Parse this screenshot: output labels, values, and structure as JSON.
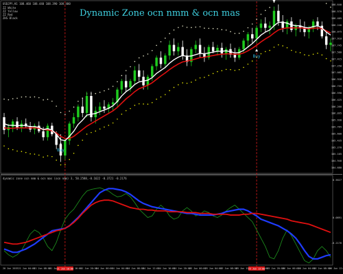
{
  "window": {
    "symbol_line": "USDJPY,H1  108.460 108.440 108.390 108.400",
    "legend_items": [
      "ZZ White",
      "ZZ Yellow",
      "ZZ Red",
      "ZHS Black"
    ],
    "title": "Dynamic Zone ocn nmm & ocn mas"
  },
  "indicator_panel": {
    "label": "dynamic zone ocn nmm & ocn mas (ocn nmm) 3, 50.2588,-0.1622 -0.3721 -0.2176"
  },
  "colors": {
    "background": "#000000",
    "bull_candle": "#1ecb1e",
    "bear_candle": "#ffffff",
    "white_ma": "#ffffff",
    "red_ma": "#e01010",
    "upper_dots": "#e6e6c8",
    "lower_dots": "#e6e600",
    "signal_text": "#2fb6e0",
    "blue_line": "#1f3cff",
    "green_line": "#1c8a1c",
    "vline": "#d81a1a"
  },
  "chart_data": [
    {
      "type": "candlestick",
      "title": "Dynamic Zone ocn nmm & ocn mas",
      "ylim": [
        104.68,
        108.64
      ],
      "y_ticks": [
        "108.640",
        "108.570",
        "108.405",
        "108.240",
        "108.075",
        "107.910",
        "107.745",
        "107.580",
        "107.415",
        "107.250",
        "107.085",
        "106.920",
        "106.755",
        "106.590",
        "106.425",
        "106.260",
        "106.095",
        "105.930",
        "105.765",
        "105.600",
        "105.435",
        "105.270",
        "105.105",
        "104.940",
        "104.680"
      ],
      "x_ticks": [
        "20 Jun 2019",
        "21 Jun 04:00",
        "21 Jun 08:00",
        "21 Jun 12:00",
        "21 Jun 16:00",
        "21 Jun 20:00",
        "24 Jun 00:00",
        "24 Jun 04:00",
        "24 Jun 08:00",
        "24 Jun 12:00",
        "24 Jun 16:00",
        "24 Jun 20:00",
        "25 Jun 00:00",
        "25 Jun 04:00",
        "25 Jun 08:00",
        "25 Jun 12:00",
        "25 Jun 16:00",
        "25 Jun 20:00",
        "26 Jun 00:00",
        "26 Jun 04:00",
        "26 Jun 08:00",
        "26 Jun 12:00"
      ],
      "highlighted_x_ticks": [
        "21 Jun 10:00",
        "25 Jun 13:00"
      ],
      "vertical_lines_at_candle": [
        14,
        58
      ],
      "candles": [
        {
          "o": 105.95,
          "h": 106.05,
          "l": 105.55,
          "c": 105.65
        },
        {
          "o": 105.65,
          "h": 105.8,
          "l": 105.48,
          "c": 105.72
        },
        {
          "o": 105.72,
          "h": 105.9,
          "l": 105.6,
          "c": 105.85
        },
        {
          "o": 105.85,
          "h": 105.95,
          "l": 105.65,
          "c": 105.7
        },
        {
          "o": 105.7,
          "h": 105.88,
          "l": 105.6,
          "c": 105.8
        },
        {
          "o": 105.8,
          "h": 105.92,
          "l": 105.7,
          "c": 105.74
        },
        {
          "o": 105.74,
          "h": 105.84,
          "l": 105.6,
          "c": 105.66
        },
        {
          "o": 105.66,
          "h": 105.8,
          "l": 105.55,
          "c": 105.75
        },
        {
          "o": 105.75,
          "h": 105.85,
          "l": 105.58,
          "c": 105.62
        },
        {
          "o": 105.62,
          "h": 105.72,
          "l": 105.4,
          "c": 105.48
        },
        {
          "o": 105.48,
          "h": 105.8,
          "l": 105.4,
          "c": 105.75
        },
        {
          "o": 105.75,
          "h": 105.82,
          "l": 105.5,
          "c": 105.55
        },
        {
          "o": 105.55,
          "h": 105.62,
          "l": 105.2,
          "c": 105.3
        },
        {
          "o": 105.3,
          "h": 105.55,
          "l": 104.9,
          "c": 105.05
        },
        {
          "o": 105.05,
          "h": 105.45,
          "l": 104.95,
          "c": 105.4
        },
        {
          "o": 105.4,
          "h": 105.85,
          "l": 105.3,
          "c": 105.8
        },
        {
          "o": 105.8,
          "h": 106.05,
          "l": 105.7,
          "c": 105.95
        },
        {
          "o": 105.95,
          "h": 106.25,
          "l": 105.85,
          "c": 106.2
        },
        {
          "o": 106.2,
          "h": 106.4,
          "l": 105.95,
          "c": 106.05
        },
        {
          "o": 106.05,
          "h": 106.55,
          "l": 105.95,
          "c": 106.45
        },
        {
          "o": 106.45,
          "h": 106.55,
          "l": 105.85,
          "c": 105.95
        },
        {
          "o": 105.95,
          "h": 106.2,
          "l": 105.8,
          "c": 106.1
        },
        {
          "o": 106.1,
          "h": 106.3,
          "l": 106.0,
          "c": 106.2
        },
        {
          "o": 106.2,
          "h": 106.35,
          "l": 106.05,
          "c": 106.15
        },
        {
          "o": 106.15,
          "h": 106.3,
          "l": 106.05,
          "c": 106.25
        },
        {
          "o": 106.25,
          "h": 106.4,
          "l": 106.1,
          "c": 106.3
        },
        {
          "o": 106.3,
          "h": 106.65,
          "l": 106.2,
          "c": 106.6
        },
        {
          "o": 106.6,
          "h": 106.85,
          "l": 106.5,
          "c": 106.8
        },
        {
          "o": 106.8,
          "h": 106.95,
          "l": 106.55,
          "c": 106.65
        },
        {
          "o": 106.65,
          "h": 106.85,
          "l": 106.55,
          "c": 106.8
        },
        {
          "o": 106.8,
          "h": 107.15,
          "l": 106.7,
          "c": 107.05
        },
        {
          "o": 107.05,
          "h": 107.2,
          "l": 106.8,
          "c": 106.9
        },
        {
          "o": 106.9,
          "h": 107.05,
          "l": 106.6,
          "c": 106.7
        },
        {
          "o": 106.7,
          "h": 106.95,
          "l": 106.6,
          "c": 106.9
        },
        {
          "o": 106.9,
          "h": 107.2,
          "l": 106.8,
          "c": 107.15
        },
        {
          "o": 107.15,
          "h": 107.4,
          "l": 107.05,
          "c": 107.35
        },
        {
          "o": 107.35,
          "h": 107.5,
          "l": 107.1,
          "c": 107.2
        },
        {
          "o": 107.2,
          "h": 107.45,
          "l": 107.1,
          "c": 107.4
        },
        {
          "o": 107.4,
          "h": 107.75,
          "l": 107.3,
          "c": 107.65
        },
        {
          "o": 107.65,
          "h": 107.8,
          "l": 107.4,
          "c": 107.5
        },
        {
          "o": 107.5,
          "h": 107.7,
          "l": 107.4,
          "c": 107.6
        },
        {
          "o": 107.6,
          "h": 107.75,
          "l": 107.3,
          "c": 107.4
        },
        {
          "o": 107.4,
          "h": 107.55,
          "l": 107.15,
          "c": 107.25
        },
        {
          "o": 107.25,
          "h": 107.6,
          "l": 107.15,
          "c": 107.55
        },
        {
          "o": 107.55,
          "h": 107.75,
          "l": 107.45,
          "c": 107.65
        },
        {
          "o": 107.65,
          "h": 107.8,
          "l": 107.35,
          "c": 107.45
        },
        {
          "o": 107.45,
          "h": 107.6,
          "l": 107.25,
          "c": 107.35
        },
        {
          "o": 107.35,
          "h": 107.65,
          "l": 107.3,
          "c": 107.6
        },
        {
          "o": 107.6,
          "h": 107.72,
          "l": 107.45,
          "c": 107.5
        },
        {
          "o": 107.5,
          "h": 107.65,
          "l": 107.4,
          "c": 107.58
        },
        {
          "o": 107.58,
          "h": 107.7,
          "l": 107.35,
          "c": 107.45
        },
        {
          "o": 107.45,
          "h": 107.6,
          "l": 107.3,
          "c": 107.55
        },
        {
          "o": 107.55,
          "h": 107.68,
          "l": 107.35,
          "c": 107.42
        },
        {
          "o": 107.42,
          "h": 107.58,
          "l": 107.25,
          "c": 107.35
        },
        {
          "o": 107.35,
          "h": 107.6,
          "l": 107.3,
          "c": 107.55
        },
        {
          "o": 107.55,
          "h": 107.8,
          "l": 107.45,
          "c": 107.75
        },
        {
          "o": 107.75,
          "h": 107.95,
          "l": 107.6,
          "c": 107.9
        },
        {
          "o": 107.9,
          "h": 108.05,
          "l": 107.7,
          "c": 107.8
        },
        {
          "o": 107.8,
          "h": 108.1,
          "l": 107.7,
          "c": 108.05
        },
        {
          "o": 108.05,
          "h": 108.25,
          "l": 107.95,
          "c": 108.15
        },
        {
          "o": 108.15,
          "h": 108.3,
          "l": 107.95,
          "c": 108.05
        },
        {
          "o": 108.05,
          "h": 108.2,
          "l": 107.9,
          "c": 108.1
        },
        {
          "o": 108.1,
          "h": 108.55,
          "l": 108.0,
          "c": 108.45
        },
        {
          "o": 108.45,
          "h": 108.6,
          "l": 108.1,
          "c": 108.2
        },
        {
          "o": 108.2,
          "h": 108.35,
          "l": 107.95,
          "c": 108.05
        },
        {
          "o": 108.05,
          "h": 108.25,
          "l": 107.9,
          "c": 108.2
        },
        {
          "o": 108.2,
          "h": 108.3,
          "l": 107.95,
          "c": 108.0
        },
        {
          "o": 108.0,
          "h": 108.15,
          "l": 107.85,
          "c": 108.1
        },
        {
          "o": 108.1,
          "h": 108.25,
          "l": 107.95,
          "c": 108.05
        },
        {
          "o": 108.05,
          "h": 108.2,
          "l": 107.85,
          "c": 107.95
        },
        {
          "o": 107.95,
          "h": 108.1,
          "l": 107.8,
          "c": 108.05
        },
        {
          "o": 108.05,
          "h": 108.25,
          "l": 107.95,
          "c": 108.2
        },
        {
          "o": 108.2,
          "h": 108.3,
          "l": 108.0,
          "c": 108.1
        },
        {
          "o": 108.1,
          "h": 108.2,
          "l": 107.8,
          "c": 107.85
        },
        {
          "o": 107.85,
          "h": 107.95,
          "l": 107.55,
          "c": 107.65
        },
        {
          "o": 107.65,
          "h": 107.8,
          "l": 107.5,
          "c": 107.7
        }
      ],
      "white_ma": [
        105.8,
        105.76,
        105.76,
        105.75,
        105.76,
        105.75,
        105.73,
        105.73,
        105.71,
        105.66,
        105.68,
        105.65,
        105.55,
        105.42,
        105.4,
        105.5,
        105.62,
        105.78,
        105.88,
        106.0,
        106.02,
        106.04,
        106.08,
        106.12,
        106.16,
        106.22,
        106.32,
        106.45,
        106.55,
        106.62,
        106.72,
        106.78,
        106.8,
        106.82,
        106.88,
        106.98,
        107.05,
        107.12,
        107.22,
        107.3,
        107.36,
        107.4,
        107.38,
        107.39,
        107.42,
        107.45,
        107.44,
        107.46,
        107.48,
        107.5,
        107.5,
        107.51,
        107.49,
        107.46,
        107.47,
        107.52,
        107.6,
        107.68,
        107.78,
        107.88,
        107.95,
        108.0,
        108.1,
        108.18,
        108.18,
        108.16,
        108.12,
        108.1,
        108.1,
        108.06,
        108.05,
        108.08,
        108.1,
        108.05,
        107.95,
        107.88
      ],
      "red_ma": [
        105.7,
        105.69,
        105.69,
        105.7,
        105.7,
        105.7,
        105.7,
        105.7,
        105.69,
        105.66,
        105.65,
        105.63,
        105.58,
        105.5,
        105.45,
        105.45,
        105.5,
        105.58,
        105.66,
        105.74,
        105.8,
        105.86,
        105.92,
        105.98,
        106.04,
        106.1,
        106.18,
        106.28,
        106.38,
        106.46,
        106.55,
        106.62,
        106.66,
        106.7,
        106.76,
        106.84,
        106.92,
        106.99,
        107.07,
        107.14,
        107.2,
        107.25,
        107.27,
        107.29,
        107.32,
        107.35,
        107.36,
        107.38,
        107.4,
        107.42,
        107.43,
        107.44,
        107.44,
        107.43,
        107.43,
        107.46,
        107.51,
        107.57,
        107.64,
        107.72,
        107.79,
        107.85,
        107.93,
        108.0,
        108.03,
        108.05,
        108.05,
        108.05,
        108.05,
        108.04,
        108.03,
        108.04,
        108.05,
        108.03,
        107.98,
        107.93
      ],
      "signals": [
        {
          "label": "Buy",
          "candle": 13,
          "price": 105.15
        },
        {
          "label": "Buy",
          "candle": 58,
          "price": 107.35
        },
        {
          "label": "Sell",
          "candle": 62,
          "price": 108.8
        }
      ]
    },
    {
      "type": "line",
      "title": "dynamic zone ocn nmm & ocn mas (ocn nmm) 3, 50.2588,-0.1622 -0.3721 -0.2176",
      "ylim": [
        -0.45,
        0.56
      ],
      "y_ticks": [
        "0.5627",
        "0.0891",
        "-0.2176"
      ],
      "series": [
        {
          "color": "red",
          "values": [
            -0.2,
            -0.21,
            -0.22,
            -0.22,
            -0.21,
            -0.2,
            -0.18,
            -0.16,
            -0.14,
            -0.12,
            -0.1,
            -0.08,
            -0.06,
            -0.05,
            -0.03,
            0.0,
            0.04,
            0.09,
            0.15,
            0.2,
            0.25,
            0.28,
            0.3,
            0.31,
            0.31,
            0.3,
            0.28,
            0.26,
            0.24,
            0.22,
            0.21,
            0.2,
            0.2,
            0.19,
            0.19,
            0.18,
            0.18,
            0.18,
            0.17,
            0.17,
            0.17,
            0.17,
            0.16,
            0.16,
            0.16,
            0.15,
            0.15,
            0.15,
            0.14,
            0.14,
            0.14,
            0.14,
            0.13,
            0.13,
            0.13,
            0.14,
            0.14,
            0.15,
            0.15,
            0.14,
            0.13,
            0.12,
            0.11,
            0.1,
            0.09,
            0.08,
            0.06,
            0.05,
            0.04,
            0.03,
            0.02,
            0.0,
            -0.02,
            -0.04,
            -0.06,
            -0.08
          ]
        },
        {
          "color": "blue",
          "values": [
            -0.28,
            -0.3,
            -0.32,
            -0.32,
            -0.3,
            -0.28,
            -0.25,
            -0.22,
            -0.18,
            -0.14,
            -0.1,
            -0.06,
            -0.05,
            -0.04,
            -0.03,
            0.0,
            0.05,
            0.1,
            0.16,
            0.22,
            0.28,
            0.34,
            0.4,
            0.43,
            0.45,
            0.45,
            0.44,
            0.43,
            0.41,
            0.38,
            0.34,
            0.3,
            0.27,
            0.25,
            0.23,
            0.22,
            0.21,
            0.2,
            0.19,
            0.18,
            0.17,
            0.16,
            0.15,
            0.15,
            0.14,
            0.13,
            0.13,
            0.13,
            0.13,
            0.14,
            0.15,
            0.17,
            0.18,
            0.19,
            0.2,
            0.2,
            0.18,
            0.15,
            0.12,
            0.08,
            0.06,
            0.04,
            0.02,
            0.0,
            -0.03,
            -0.06,
            -0.1,
            -0.15,
            -0.22,
            -0.3,
            -0.37,
            -0.4,
            -0.4,
            -0.38,
            -0.36,
            -0.35
          ]
        },
        {
          "color": "green",
          "values": [
            -0.3,
            -0.35,
            -0.38,
            -0.35,
            -0.3,
            -0.2,
            -0.1,
            -0.05,
            -0.08,
            -0.15,
            -0.25,
            -0.3,
            -0.2,
            -0.05,
            0.08,
            0.15,
            0.2,
            0.28,
            0.36,
            0.42,
            0.44,
            0.45,
            0.46,
            0.44,
            0.42,
            0.38,
            0.35,
            0.36,
            0.39,
            0.35,
            0.28,
            0.2,
            0.15,
            0.1,
            0.12,
            0.2,
            0.25,
            0.2,
            0.12,
            0.08,
            0.1,
            0.18,
            0.22,
            0.18,
            0.12,
            0.14,
            0.18,
            0.16,
            0.12,
            0.1,
            0.13,
            0.18,
            0.22,
            0.25,
            0.2,
            0.15,
            0.1,
            0.05,
            -0.05,
            -0.15,
            -0.25,
            -0.38,
            -0.4,
            -0.3,
            -0.15,
            -0.05,
            -0.12,
            -0.22,
            -0.32,
            -0.42,
            -0.45,
            -0.4,
            -0.3,
            -0.25,
            -0.3,
            -0.38
          ]
        }
      ]
    }
  ]
}
